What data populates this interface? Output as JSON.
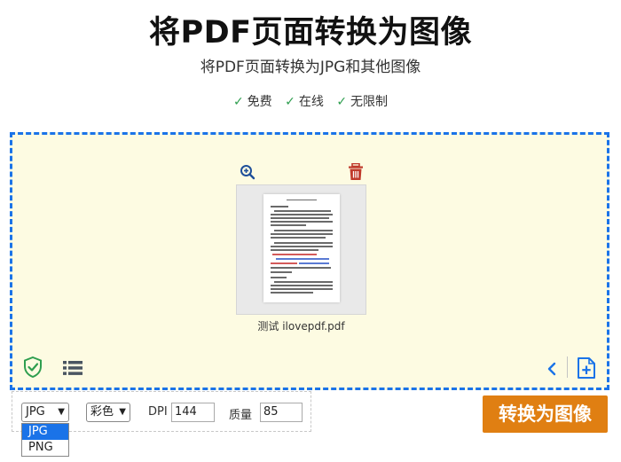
{
  "header": {
    "title": "将PDF页面转换为图像",
    "subtitle": "将PDF页面转换为JPG和其他图像",
    "features": [
      "免费",
      "在线",
      "无限制"
    ],
    "check_symbol": "✓"
  },
  "file": {
    "name": "测试 ilovepdf.pdf"
  },
  "options": {
    "format": {
      "selected": "JPG",
      "options": [
        "JPG",
        "PNG"
      ]
    },
    "color": {
      "selected": "彩色"
    },
    "dpi_label": "DPI",
    "dpi_value": "144",
    "quality_label": "质量",
    "quality_value": "85"
  },
  "actions": {
    "convert_label": "转换为图像"
  },
  "colors": {
    "accent_blue": "#1a73e8",
    "convert_orange": "#e07f12",
    "dropzone_bg": "#fdfbe2",
    "check_green": "#2e9e4f",
    "trash_red": "#c0392b"
  },
  "icons": [
    "zoom-in-icon",
    "trash-icon",
    "shield-check-icon",
    "list-view-icon",
    "chevron-left-icon",
    "add-file-icon"
  ]
}
